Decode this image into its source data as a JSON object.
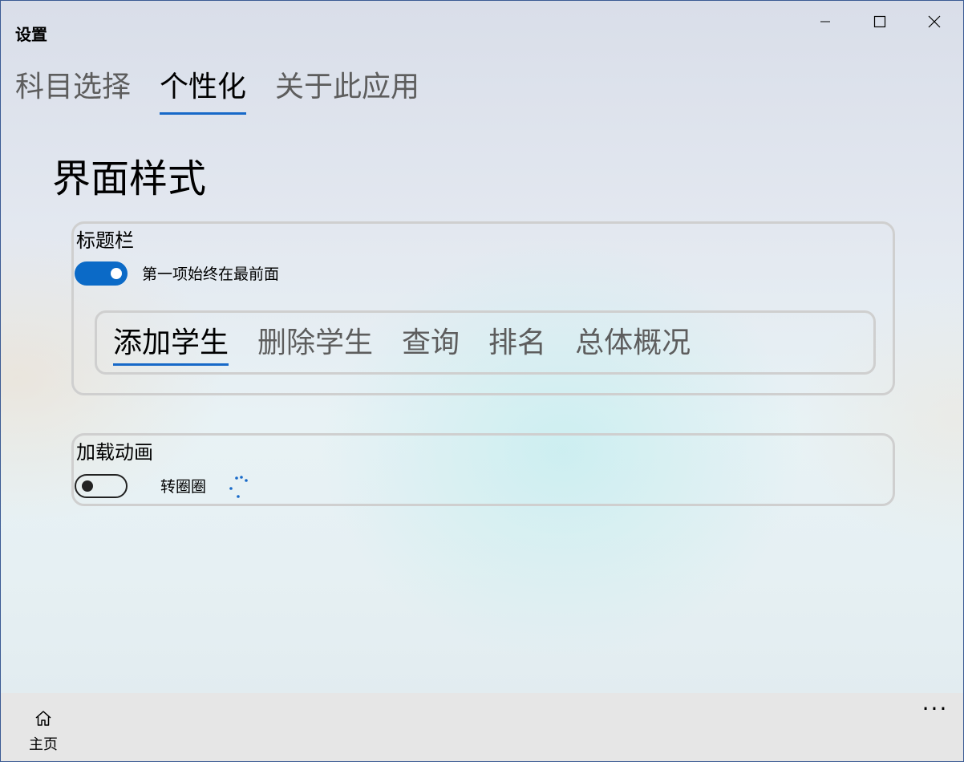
{
  "window": {
    "title": "设置"
  },
  "top_tabs": [
    {
      "label": "科目选择",
      "selected": false
    },
    {
      "label": "个性化",
      "selected": true
    },
    {
      "label": "关于此应用",
      "selected": false
    }
  ],
  "section": {
    "title": "界面样式"
  },
  "titlebar_card": {
    "title": "标题栏",
    "toggle_on": true,
    "toggle_label": "第一项始终在最前面",
    "preview_tabs": [
      {
        "label": "添加学生",
        "selected": true
      },
      {
        "label": "删除学生",
        "selected": false
      },
      {
        "label": "查询",
        "selected": false
      },
      {
        "label": "排名",
        "selected": false
      },
      {
        "label": "总体概况",
        "selected": false
      }
    ]
  },
  "loading_card": {
    "title": "加载动画",
    "toggle_on": false,
    "toggle_label": "转圈圈"
  },
  "bottom_bar": {
    "home_label": "主页",
    "more_label": "···"
  },
  "colors": {
    "accent": "#0b6ac7",
    "card_border": "#cfcfcf",
    "bottom_bar": "#e6e6e6"
  }
}
